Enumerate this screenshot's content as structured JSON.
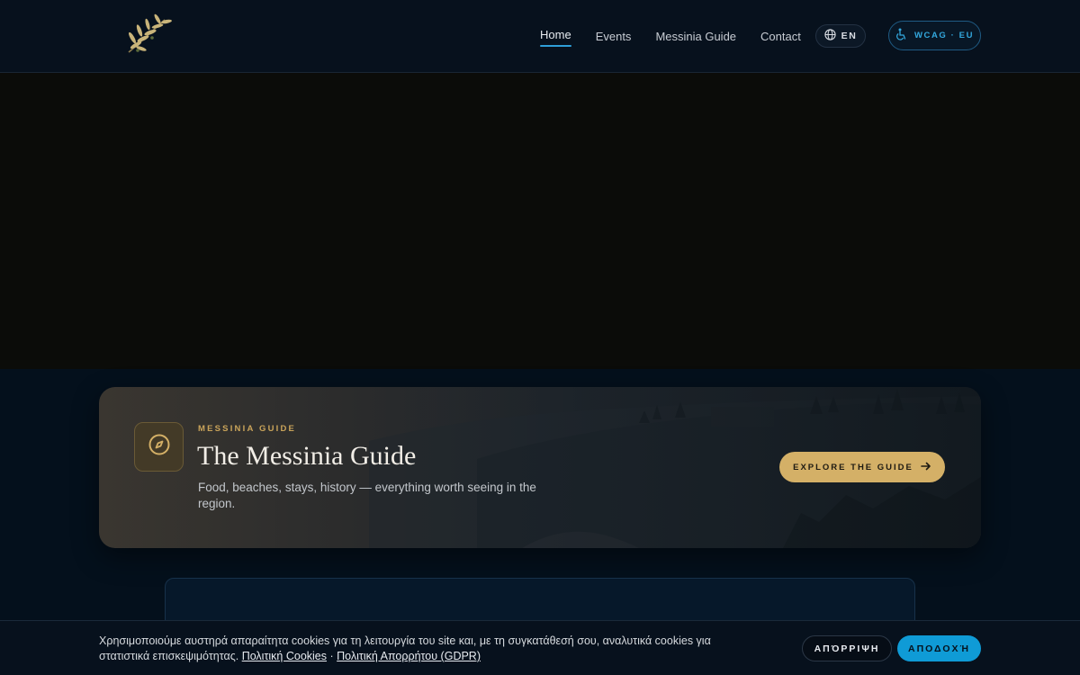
{
  "header": {
    "nav": [
      {
        "label": "Home",
        "active": true
      },
      {
        "label": "Events",
        "active": false
      },
      {
        "label": "Messinia Guide",
        "active": false
      },
      {
        "label": "Contact",
        "active": false
      }
    ],
    "lang_label": "EN",
    "wcag_label": "WCAG · EU",
    "icons": {
      "logo": "olive-branch-logo",
      "lang": "globe-icon",
      "wcag": "accessibility-icon"
    }
  },
  "guide_card": {
    "eyebrow": "MESSINIA GUIDE",
    "title": "The Messinia Guide",
    "description": "Food, beaches, stays, history — everything worth seeing in the region.",
    "button_label": "EXPLORE THE GUIDE",
    "icons": {
      "badge": "compass-icon",
      "button": "arrow-right-icon"
    }
  },
  "cookie_bar": {
    "text": "Χρησιμοποιούμε αυστηρά απαραίτητα cookies για τη λειτουργία του site και, με τη συγκατάθεσή σου, αναλυτικά cookies για στατιστικά επισκεψιμότητας.",
    "link_cookies": "Πολιτική Cookies",
    "separator": "·",
    "link_privacy": "Πολιτική Απορρήτου (GDPR)",
    "reject_label": "ΑΠΌΡΡΙΨΗ",
    "accept_label": "ΑΠΟΔΟΧΉ"
  },
  "colors": {
    "accent_blue": "#2f9fd8",
    "gold": "#d4b067",
    "page_bg": "#04101c"
  }
}
